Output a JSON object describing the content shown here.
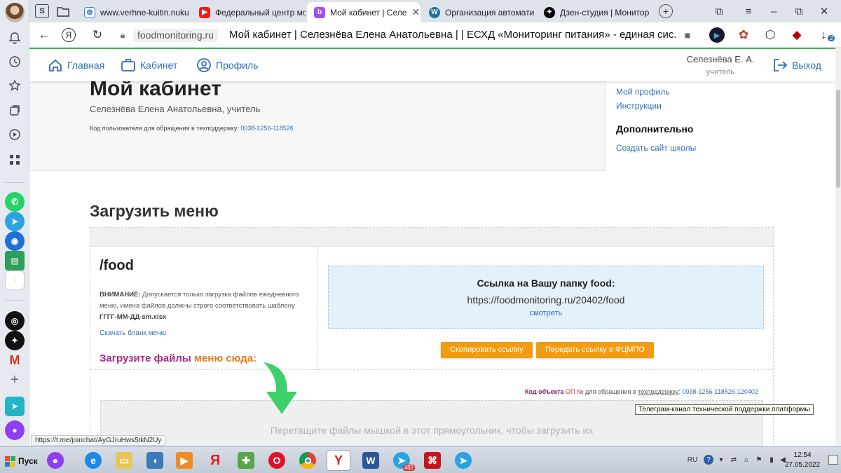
{
  "browser": {
    "tabs": [
      {
        "title": "www.verhne-kuitin.nuku",
        "icon": "globe-icon",
        "color": "#3a7bd5"
      },
      {
        "title": "Федеральный центр мо",
        "icon": "youtube-icon",
        "color": "#e62117"
      },
      {
        "title": "Мой кабинет | Селе",
        "icon": "foodmonitoring-icon",
        "color": "#a64bf4",
        "active": true
      },
      {
        "title": "Организация автомати",
        "icon": "wordpress-icon",
        "color": "#21759b"
      },
      {
        "title": "Дзен-студия | Монитор",
        "icon": "zen-icon",
        "color": "#000000"
      }
    ],
    "address": {
      "domain": "foodmonitoring.ru",
      "page_title": "Мой кабинет | Селезнёва Елена Анатольевна | | ЕСХД «Мониторинг питания» - единая сис..."
    },
    "download_badge": "2",
    "status_url": "https://t.me/joinchat/AyGJruHws5tkN2Uy"
  },
  "site_nav": {
    "home": "Главная",
    "cabinet": "Кабинет",
    "profile": "Профиль",
    "user_name": "Селезнёва Е. А.",
    "user_role": "учитель",
    "logout": "Выход"
  },
  "cabinet": {
    "title": "Мой кабинет",
    "subtitle": "Селезнёва Елена Анатольевна, учитель",
    "code_label": "Код пользователя для обращения в техподдержку:",
    "code_value": "0038-1256-118526",
    "right_links": [
      "Мой профиль",
      "Инструкции"
    ],
    "extra_title": "Дополнительно",
    "extra_link": "Создать сайт школы"
  },
  "upload": {
    "section_title": "Загрузить меню",
    "folder_title": "/food",
    "warning_bold": "ВНИМАНИЕ:",
    "warning_text": "Допускается только загрузка файлов ежедневного меню, имена файлов должны строго соответствовать шаблону",
    "template_name": "ГГГГ-ММ-ДД-sm.xlsx",
    "blank_link": "Скачать бланк меню",
    "drop_hint_part1": "Загрузите файлы",
    "drop_hint_part2": "меню сюда:",
    "link_label": "Ссылка на Вашу папку food:",
    "link_url": "https://foodmonitoring.ru/20402/food",
    "link_view": "смотреть",
    "btn_copy": "Скопировать ссылку",
    "btn_send": "Передать ссылку в ФЦМПО",
    "obj_code_p1": "Код объекта",
    "obj_code_p2": "ОП №",
    "obj_code_p3": "для обращения в",
    "obj_code_p4": "техподдержку",
    "obj_code_value": "0038-1256-118526-120402",
    "drop_text": "Перетащите файлы мышкой в этот прямоугольник, чтобы загрузить их",
    "tooltip": "Телеграм-канал технической поддержки платформы"
  },
  "taskbar": {
    "start_label": "Пуск",
    "telegram_badge": "482",
    "lang": "RU",
    "time": "12:54",
    "date": "27.05.2022"
  }
}
